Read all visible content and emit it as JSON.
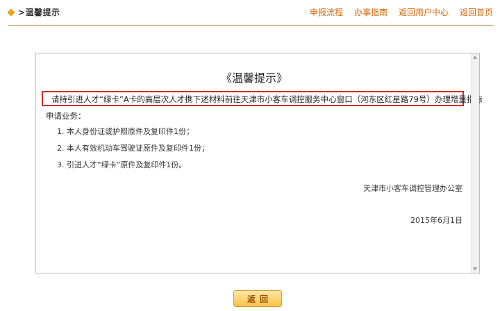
{
  "header": {
    "breadcrumb": ">温馨提示",
    "nav": [
      "申报流程",
      "办事指南",
      "返回用户中心",
      "返回首页"
    ]
  },
  "notice": {
    "title": "《温馨提示》",
    "line1": "请持引进人才“绿卡”A卡的高层次人才携下述材料前往天津市小客车调控服务中心窗口（河东区红星路79号）办理增量指标",
    "line2": "申请业务：",
    "requirements": [
      "1. 本人身份证或护照原件及复印件1份；",
      "2. 本人有效机动车驾驶证原件及复印件1份；",
      "3. 引进人才“绿卡”原件及复印件1份。"
    ],
    "signature": "天津市小客车调控管理办公室",
    "date": "2015年6月1日"
  },
  "footer": {
    "back_label": "返回"
  },
  "colors": {
    "accent": "#d26a0d",
    "highlight_border": "#d22a2a",
    "button_bg": "#f8c24b"
  }
}
